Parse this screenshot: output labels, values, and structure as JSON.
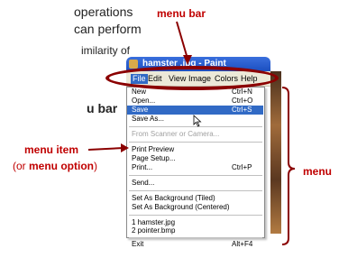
{
  "left_text": {
    "line1": "operations",
    "line2": "can perform",
    "line3": "imilarity of",
    "line4": "u bar"
  },
  "callouts": {
    "menu_bar": "menu bar",
    "menu_item": "menu item",
    "menu_item_alt_prefix": "(or ",
    "menu_item_alt": "menu option",
    "menu_item_alt_suffix": ")",
    "menu": "menu"
  },
  "window": {
    "title": "hamster .jpg - Paint"
  },
  "menubar": {
    "items": [
      "File",
      "Edit",
      "View",
      "Image",
      "Colors",
      "Help"
    ],
    "active": "File"
  },
  "dropdown": {
    "items": [
      {
        "label": "New",
        "shortcut": "Ctrl+N"
      },
      {
        "label": "Open...",
        "shortcut": "Ctrl+O"
      },
      {
        "label": "Save",
        "shortcut": "Ctrl+S",
        "highlighted": true
      },
      {
        "label": "Save As...",
        "shortcut": ""
      },
      {
        "label": "From Scanner or Camera...",
        "shortcut": "",
        "disabled": true
      },
      {
        "label": "Print Preview",
        "shortcut": ""
      },
      {
        "label": "Page Setup...",
        "shortcut": ""
      },
      {
        "label": "Print...",
        "shortcut": "Ctrl+P"
      },
      {
        "label": "Send...",
        "shortcut": ""
      },
      {
        "label": "Set As Background (Tiled)",
        "shortcut": ""
      },
      {
        "label": "Set As Background (Centered)",
        "shortcut": ""
      },
      {
        "label": "1 hamster.jpg",
        "shortcut": ""
      },
      {
        "label": "2 pointer.bmp",
        "shortcut": ""
      },
      {
        "label": "Exit",
        "shortcut": "Alt+F4"
      }
    ]
  },
  "colors": {
    "annotation": "#c00000",
    "oval": "#8b0000",
    "highlight": "#316ac5",
    "titlebar": "#1c4fc0"
  }
}
